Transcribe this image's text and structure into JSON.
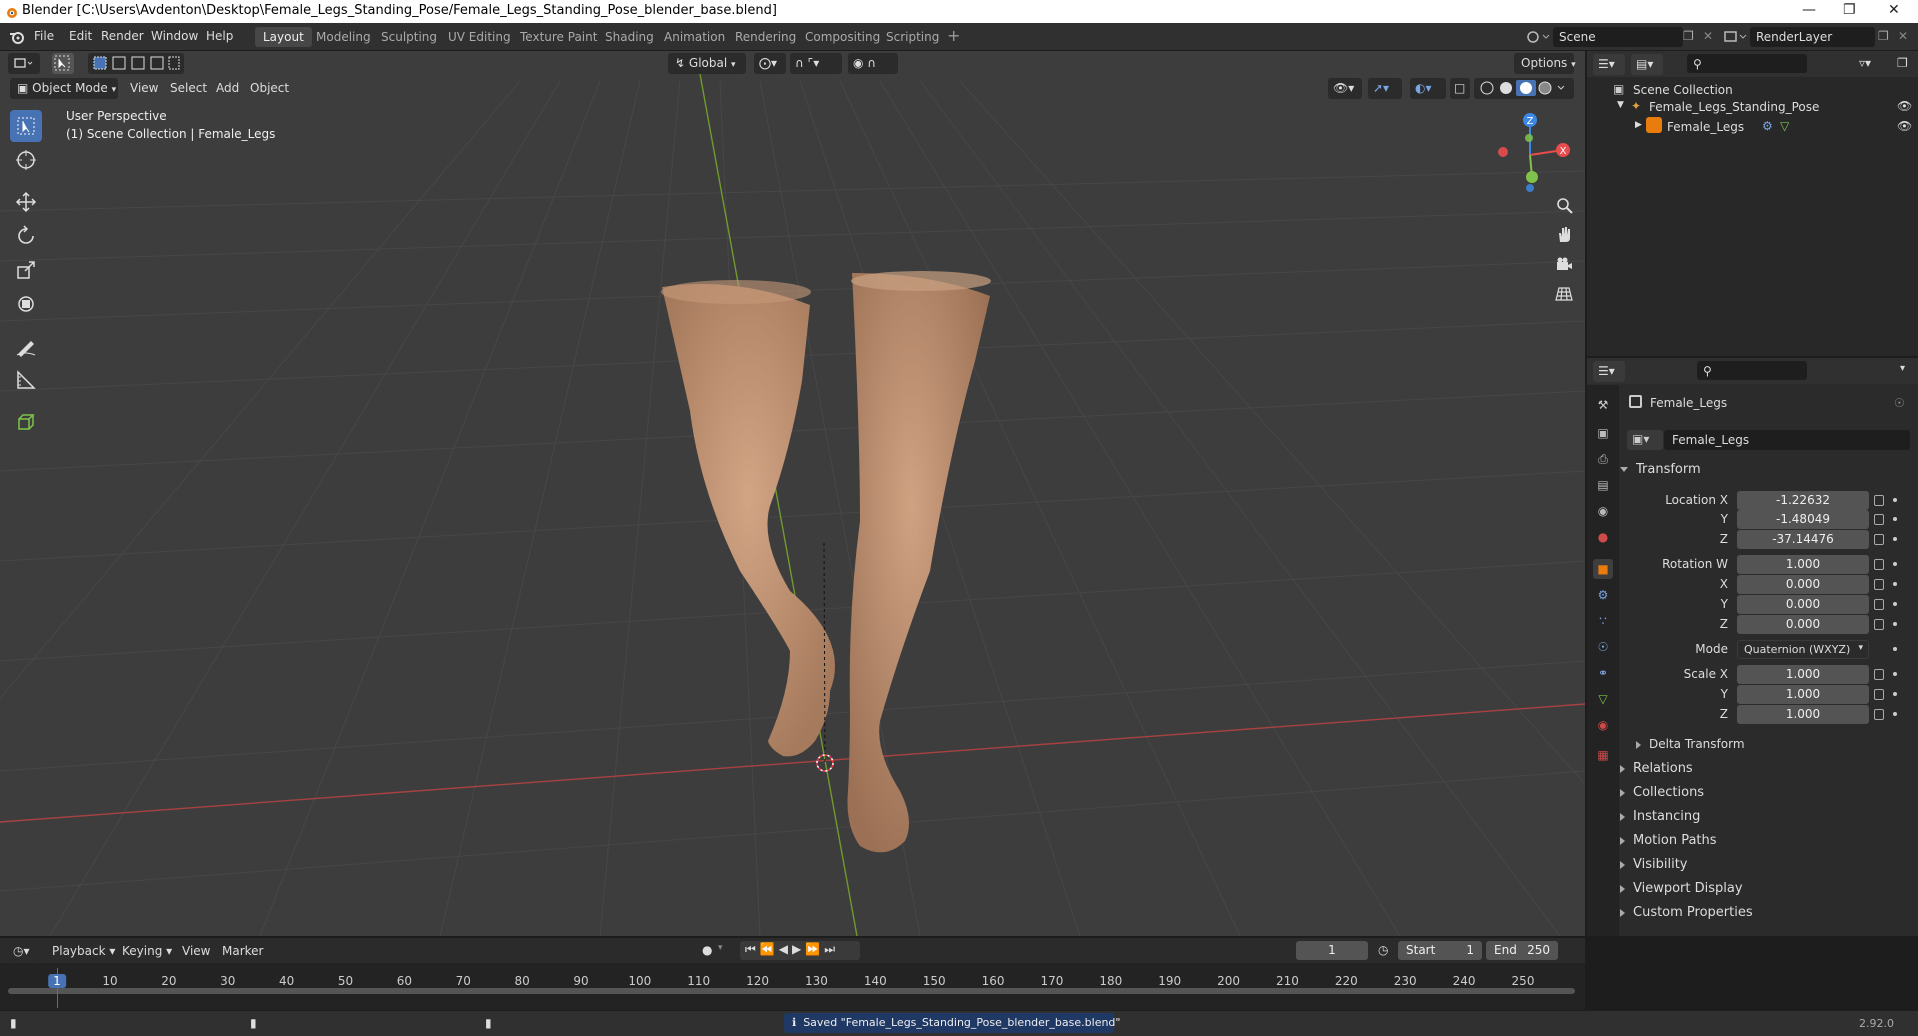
{
  "window": {
    "title": "Blender [C:\\Users\\Avdenton\\Desktop\\Female_Legs_Standing_Pose/Female_Legs_Standing_Pose_blender_base.blend]"
  },
  "menu": [
    "File",
    "Edit",
    "Render",
    "Window",
    "Help"
  ],
  "workspaces": [
    "Layout",
    "Modeling",
    "Sculpting",
    "UV Editing",
    "Texture Paint",
    "Shading",
    "Animation",
    "Rendering",
    "Compositing",
    "Scripting"
  ],
  "active_workspace": "Layout",
  "scene": "Scene",
  "view_layer": "RenderLayer",
  "viewport": {
    "orientation": "Global",
    "options": "Options",
    "mode": "Object Mode",
    "menus": [
      "View",
      "Select",
      "Add",
      "Object"
    ],
    "perspective": "User Perspective",
    "collection_info": "(1) Scene Collection | Female_Legs",
    "gizmo_axes": {
      "x": "X",
      "y": "Y",
      "z": "Z"
    }
  },
  "outliner": {
    "root": "Scene Collection",
    "items": [
      {
        "label": "Female_Legs_Standing_Pose"
      },
      {
        "label": "Female_Legs"
      }
    ]
  },
  "properties": {
    "object_name": "Female_Legs",
    "datablock": "Female_Legs",
    "transform_title": "Transform",
    "location": {
      "label": "Location X",
      "x": "-1.22632",
      "y_label": "Y",
      "y": "-1.48049",
      "z_label": "Z",
      "z": "-37.14476"
    },
    "rotation": {
      "label": "Rotation W",
      "w": "1.000",
      "x_label": "X",
      "x": "0.000",
      "y_label": "Y",
      "y": "0.000",
      "z_label": "Z",
      "z": "0.000"
    },
    "mode_label": "Mode",
    "mode_value": "Quaternion (WXYZ)",
    "scale": {
      "label": "Scale X",
      "x": "1.000",
      "y_label": "Y",
      "y": "1.000",
      "z_label": "Z",
      "z": "1.000"
    },
    "delta": "Delta Transform",
    "panels": [
      "Relations",
      "Collections",
      "Instancing",
      "Motion Paths",
      "Visibility",
      "Viewport Display",
      "Custom Properties"
    ]
  },
  "timeline": {
    "menus": [
      "Playback",
      "Keying",
      "View",
      "Marker"
    ],
    "current_frame": "1",
    "start_label": "Start",
    "start": "1",
    "end_label": "End",
    "end": "250",
    "ticks": [
      "1",
      "10",
      "20",
      "30",
      "40",
      "50",
      "60",
      "70",
      "80",
      "90",
      "100",
      "110",
      "120",
      "130",
      "140",
      "150",
      "160",
      "170",
      "180",
      "190",
      "200",
      "210",
      "220",
      "230",
      "240",
      "250"
    ]
  },
  "status": {
    "message": "Saved \"Female_Legs_Standing_Pose_blender_base.blend\"",
    "version": "2.92.0"
  },
  "colors": {
    "accent": "#4772b3",
    "x_axis": "#e94c4c",
    "y_axis": "#7fc34a",
    "z_axis": "#3c88e4",
    "skin": "#c79a7a"
  }
}
